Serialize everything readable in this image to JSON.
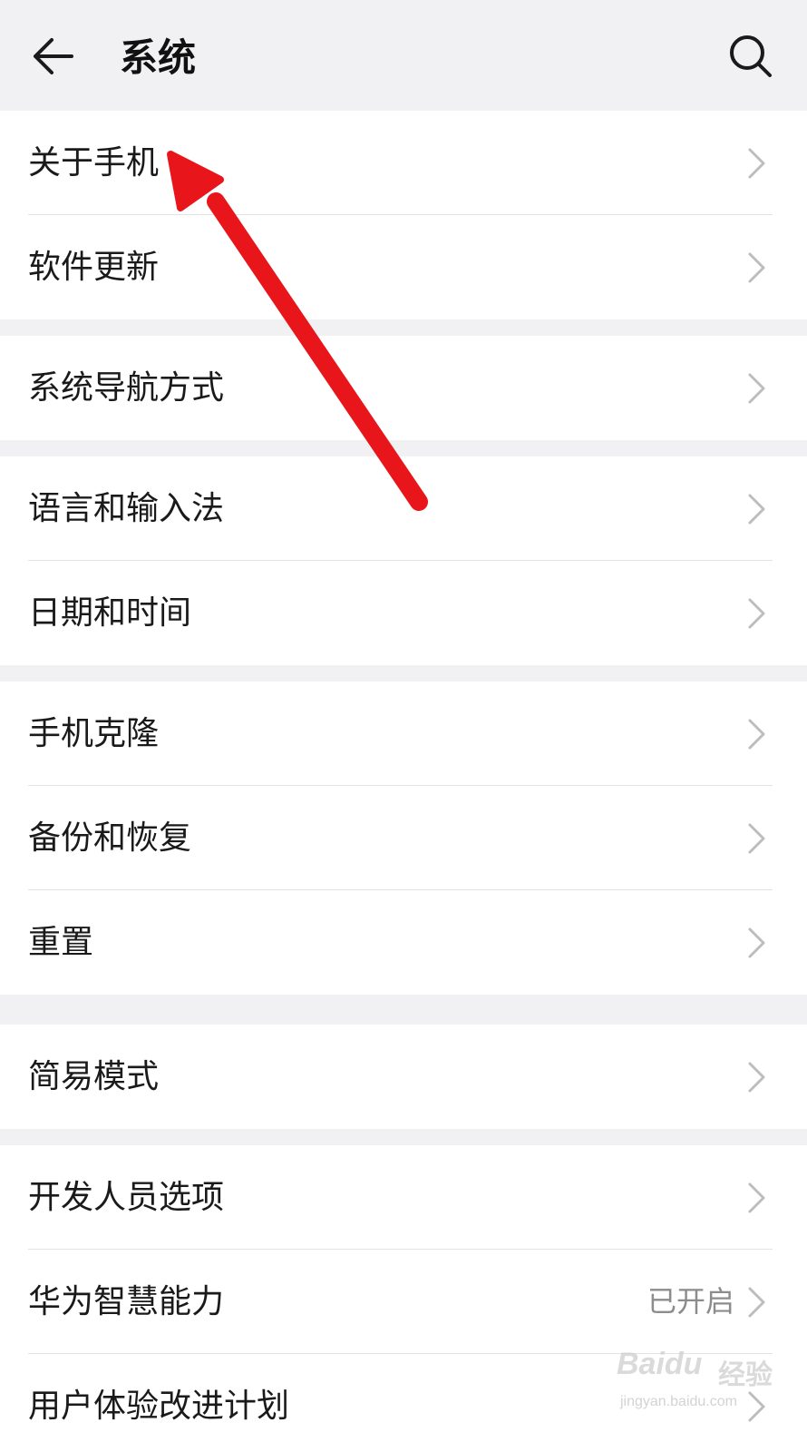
{
  "header": {
    "title": "系统",
    "back_icon": "arrow-left-icon",
    "search_icon": "search-icon"
  },
  "groups": [
    {
      "items": [
        {
          "label": "关于手机"
        },
        {
          "label": "软件更新"
        }
      ]
    },
    {
      "items": [
        {
          "label": "系统导航方式"
        }
      ]
    },
    {
      "items": [
        {
          "label": "语言和输入法"
        },
        {
          "label": "日期和时间"
        }
      ]
    },
    {
      "items": [
        {
          "label": "手机克隆"
        },
        {
          "label": "备份和恢复"
        },
        {
          "label": "重置"
        }
      ]
    },
    {
      "items": [
        {
          "label": "简易模式"
        }
      ]
    },
    {
      "items": [
        {
          "label": "开发人员选项"
        },
        {
          "label": "华为智慧能力",
          "status": "已开启"
        },
        {
          "label": "用户体验改进计划"
        }
      ]
    }
  ],
  "annotation": {
    "arrow_color": "#e8161b"
  },
  "watermark": {
    "brand": "Baidu",
    "sub": "经验",
    "url": "jingyan.baidu.com"
  },
  "colors": {
    "background": "#f1f0f3",
    "card": "#ffffff",
    "text": "#1a1a1a",
    "secondary_text": "#8c8c8c",
    "chevron": "#bdbdbd"
  }
}
